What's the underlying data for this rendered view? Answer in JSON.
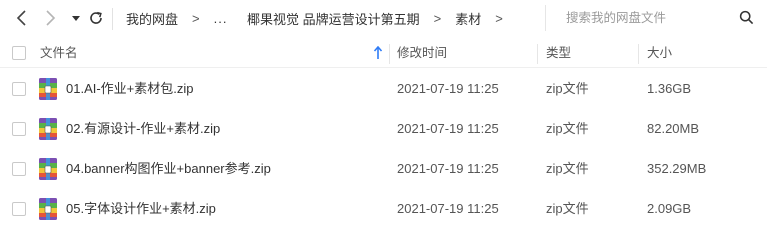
{
  "nav": {
    "back_icon": "chevron-left-icon",
    "forward_icon": "chevron-right-icon",
    "history_icon": "caret-down-icon",
    "refresh_icon": "refresh-icon"
  },
  "breadcrumb": {
    "items": [
      "我的网盘",
      "...",
      "椰果视觉 品牌运营设计第五期",
      "素材"
    ],
    "separator": ">"
  },
  "search": {
    "placeholder": "搜索我的网盘文件",
    "icon": "search-icon"
  },
  "columns": {
    "name": "文件名",
    "modified": "修改时间",
    "type": "类型",
    "size": "大小"
  },
  "sort": {
    "column": "name",
    "direction": "ascending",
    "icon": "arrow-up-icon"
  },
  "files": [
    {
      "name": "01.AI-作业+素材包.zip",
      "modified": "2021-07-19 11:25",
      "type": "zip文件",
      "size": "1.36GB",
      "icon": "archive-file-icon"
    },
    {
      "name": "02.有源设计-作业+素材.zip",
      "modified": "2021-07-19 11:25",
      "type": "zip文件",
      "size": "82.20MB",
      "icon": "archive-file-icon"
    },
    {
      "name": "04.banner构图作业+banner参考.zip",
      "modified": "2021-07-19 11:25",
      "type": "zip文件",
      "size": "352.29MB",
      "icon": "archive-file-icon"
    },
    {
      "name": "05.字体设计作业+素材.zip",
      "modified": "2021-07-19 11:25",
      "type": "zip文件",
      "size": "2.09GB",
      "icon": "archive-file-icon"
    }
  ],
  "colors": {
    "accent_blue": "#2f7cf6",
    "archive_purple": "#7b4fb3",
    "archive_green": "#58b14a",
    "archive_yellow": "#f2c53a",
    "archive_red": "#e4553a",
    "archive_blue": "#3a9be4"
  }
}
